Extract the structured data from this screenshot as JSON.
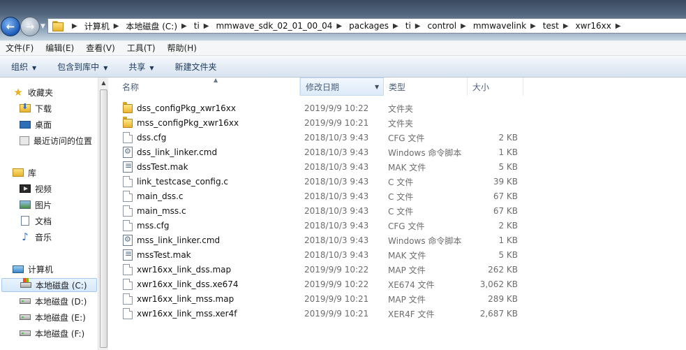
{
  "address": {
    "breadcrumbs": [
      "计算机",
      "本地磁盘 (C:)",
      "ti",
      "mmwave_sdk_02_01_00_04",
      "packages",
      "ti",
      "control",
      "mmwavelink",
      "test",
      "xwr16xx"
    ]
  },
  "menu": [
    "文件(F)",
    "编辑(E)",
    "查看(V)",
    "工具(T)",
    "帮助(H)"
  ],
  "toolbar": {
    "organize": "组织",
    "include_in_library": "包含到库中",
    "share": "共享",
    "new_folder": "新建文件夹"
  },
  "nav": {
    "favorites": "收藏夹",
    "downloads": "下载",
    "desktop": "桌面",
    "recent": "最近访问的位置",
    "libraries": "库",
    "videos": "视频",
    "pictures": "图片",
    "documents": "文档",
    "music": "音乐",
    "computer": "计算机",
    "drive_c": "本地磁盘 (C:)",
    "drive_d": "本地磁盘 (D:)",
    "drive_e": "本地磁盘 (E:)",
    "drive_f": "本地磁盘 (F:)"
  },
  "columns": {
    "name": "名称",
    "date": "修改日期",
    "type": "类型",
    "size": "大小"
  },
  "files": [
    {
      "name": "dss_configPkg_xwr16xx",
      "date": "2019/9/9 10:22",
      "type": "文件夹",
      "size": "",
      "icon": "folder"
    },
    {
      "name": "mss_configPkg_xwr16xx",
      "date": "2019/9/9 10:21",
      "type": "文件夹",
      "size": "",
      "icon": "folder"
    },
    {
      "name": "dss.cfg",
      "date": "2018/10/3 9:43",
      "type": "CFG 文件",
      "size": "2 KB",
      "icon": "file"
    },
    {
      "name": "dss_link_linker.cmd",
      "date": "2018/10/3 9:43",
      "type": "Windows 命令脚本",
      "size": "1 KB",
      "icon": "cmd"
    },
    {
      "name": "dssTest.mak",
      "date": "2018/10/3 9:43",
      "type": "MAK 文件",
      "size": "5 KB",
      "icon": "mak"
    },
    {
      "name": "link_testcase_config.c",
      "date": "2018/10/3 9:43",
      "type": "C 文件",
      "size": "39 KB",
      "icon": "file"
    },
    {
      "name": "main_dss.c",
      "date": "2018/10/3 9:43",
      "type": "C 文件",
      "size": "67 KB",
      "icon": "file"
    },
    {
      "name": "main_mss.c",
      "date": "2018/10/3 9:43",
      "type": "C 文件",
      "size": "67 KB",
      "icon": "file"
    },
    {
      "name": "mss.cfg",
      "date": "2018/10/3 9:43",
      "type": "CFG 文件",
      "size": "2 KB",
      "icon": "file"
    },
    {
      "name": "mss_link_linker.cmd",
      "date": "2018/10/3 9:43",
      "type": "Windows 命令脚本",
      "size": "1 KB",
      "icon": "cmd"
    },
    {
      "name": "mssTest.mak",
      "date": "2018/10/3 9:43",
      "type": "MAK 文件",
      "size": "5 KB",
      "icon": "mak"
    },
    {
      "name": "xwr16xx_link_dss.map",
      "date": "2019/9/9 10:22",
      "type": "MAP 文件",
      "size": "262 KB",
      "icon": "file"
    },
    {
      "name": "xwr16xx_link_dss.xe674",
      "date": "2019/9/9 10:22",
      "type": "XE674 文件",
      "size": "3,062 KB",
      "icon": "file"
    },
    {
      "name": "xwr16xx_link_mss.map",
      "date": "2019/9/9 10:21",
      "type": "MAP 文件",
      "size": "289 KB",
      "icon": "file"
    },
    {
      "name": "xwr16xx_link_mss.xer4f",
      "date": "2019/9/9 10:21",
      "type": "XER4F 文件",
      "size": "2,687 KB",
      "icon": "file"
    }
  ]
}
